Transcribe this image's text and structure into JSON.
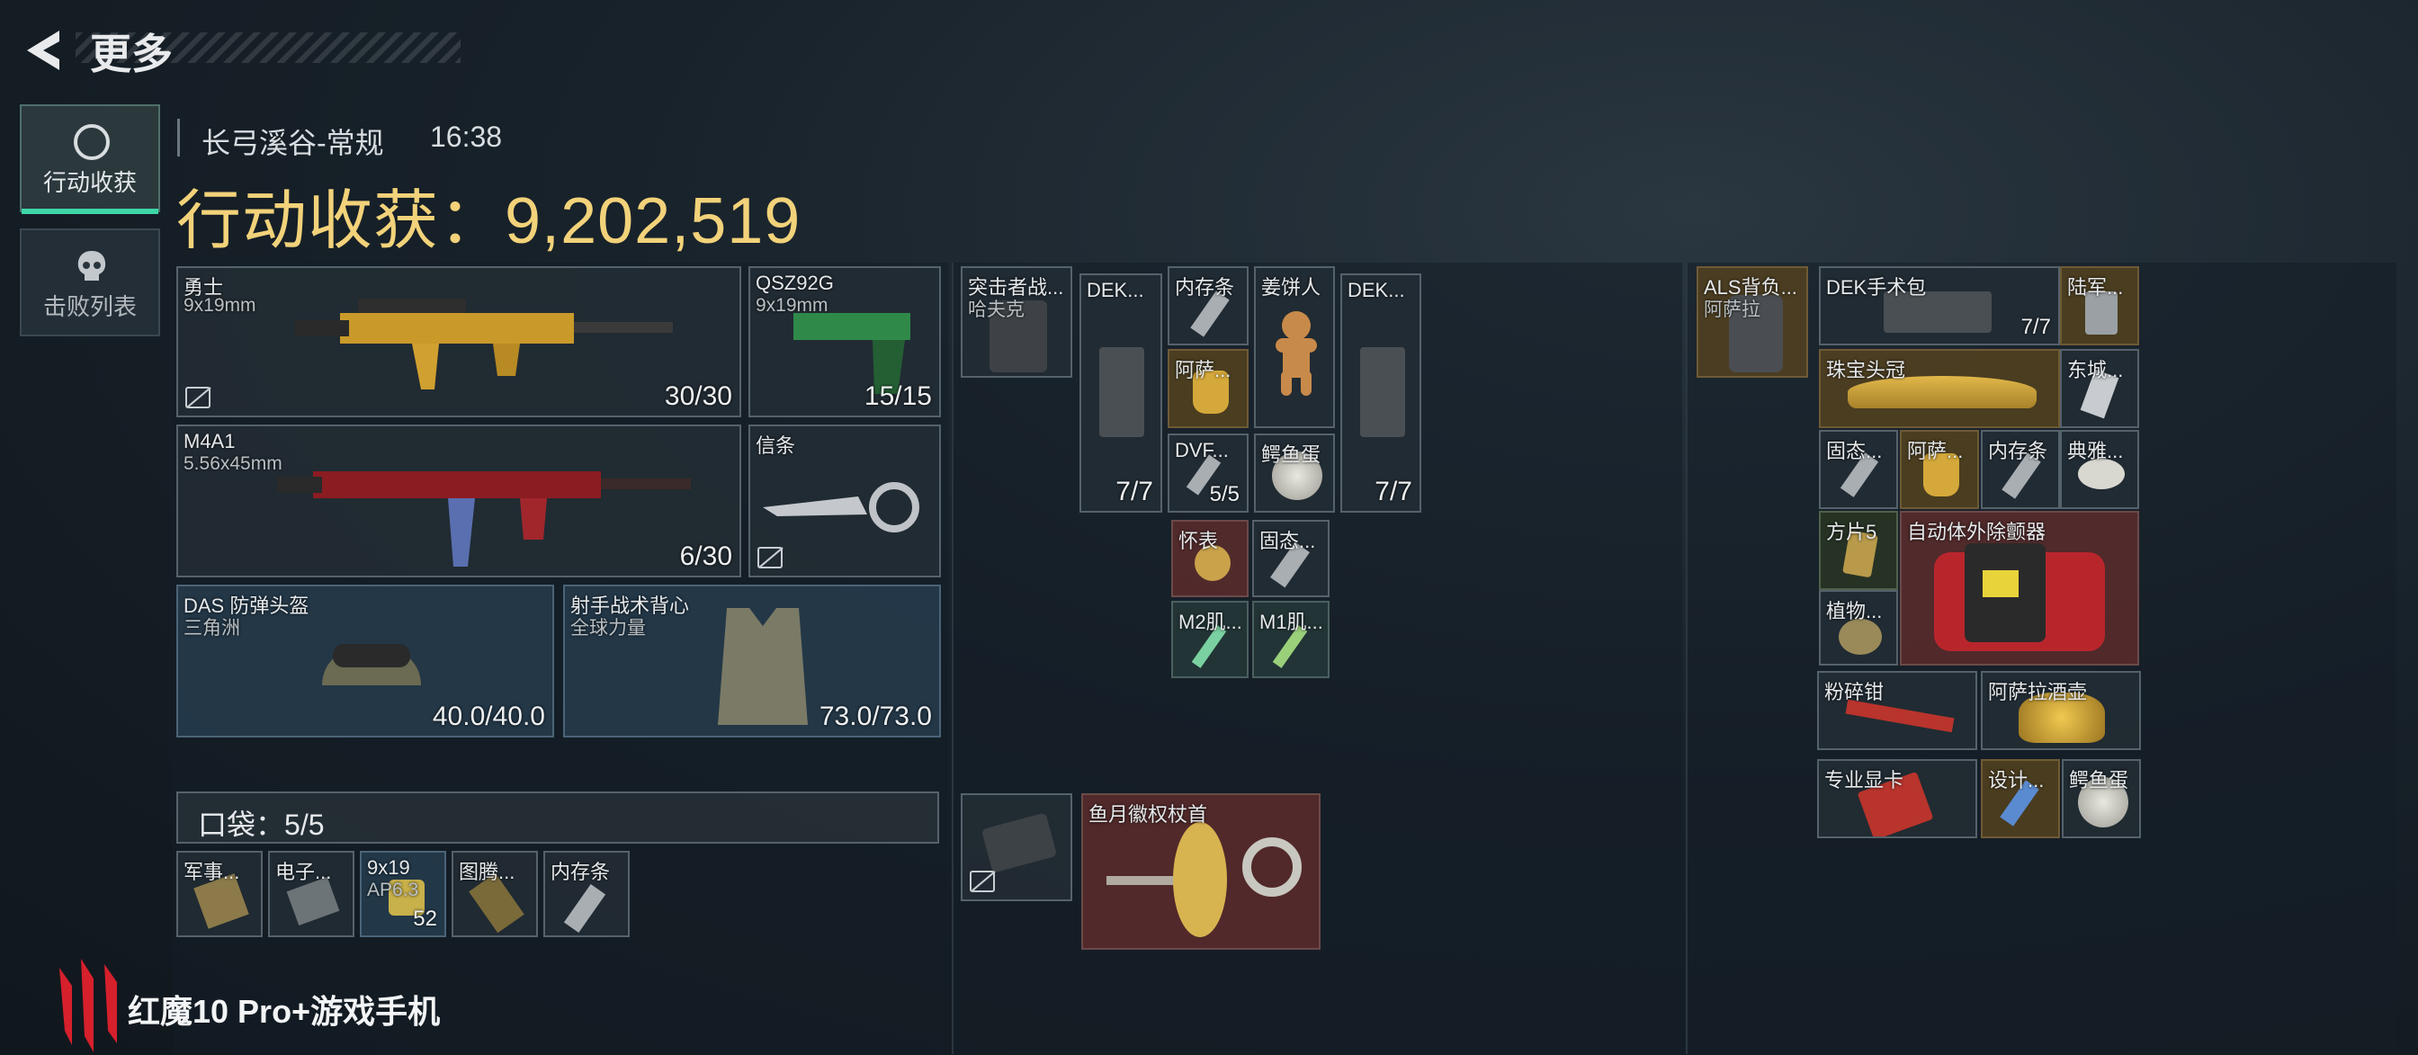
{
  "header": {
    "title": "更多"
  },
  "tabs": [
    {
      "label": "行动收获",
      "active": true
    },
    {
      "label": "击败列表",
      "active": false
    }
  ],
  "raid": {
    "map": "长弓溪谷-常规",
    "time": "16:38",
    "harvest_label": "行动收获：",
    "harvest_value": "9,202,519"
  },
  "loadout": {
    "primary1": {
      "name": "勇士",
      "ammo": "9x19mm",
      "count": "30/30"
    },
    "pistol": {
      "name": "QSZ92G",
      "ammo": "9x19mm",
      "count": "15/15"
    },
    "primary2": {
      "name": "M4A1",
      "ammo": "5.56x45mm",
      "count": "6/30"
    },
    "melee": {
      "name": "信条"
    },
    "helmet": {
      "name": "DAS 防弹头盔",
      "sub": "三角洲",
      "durability": "40.0/40.0"
    },
    "armor": {
      "name": "射手战术背心",
      "sub": "全球力量",
      "durability": "73.0/73.0"
    },
    "pocket": {
      "label": "口袋：",
      "count": "5/5"
    },
    "pocket_items": [
      {
        "name": "军事..."
      },
      {
        "name": "电子..."
      },
      {
        "name": "9x19",
        "sub": "AP6.3",
        "count": "52"
      },
      {
        "name": "图腾..."
      },
      {
        "name": "内存条"
      }
    ]
  },
  "chest_rig": {
    "rig": {
      "name": "突击者战...",
      "sub": "哈夫克"
    },
    "items": [
      {
        "name": "DEK...",
        "count": "7/7"
      },
      {
        "name": "内存条"
      },
      {
        "name": "姜饼人"
      },
      {
        "name": "DEK...",
        "count": "7/7"
      },
      {
        "name": "阿萨..."
      },
      {
        "name": "DVF...",
        "count": "5/5"
      },
      {
        "name": "鳄鱼蛋"
      },
      {
        "name": "怀表"
      },
      {
        "name": "固态..."
      },
      {
        "name": "M2肌..."
      },
      {
        "name": "M1肌..."
      }
    ],
    "special": {
      "name": "鱼月徽权杖首"
    }
  },
  "backpack": {
    "bag": {
      "name": "ALS背负...",
      "sub": "阿萨拉"
    },
    "items": [
      {
        "name": "DEK手术包",
        "count": "7/7"
      },
      {
        "name": "陆军..."
      },
      {
        "name": "珠宝头冠"
      },
      {
        "name": "东城..."
      },
      {
        "name": "固态..."
      },
      {
        "name": "阿萨..."
      },
      {
        "name": "内存条"
      },
      {
        "name": "典雅..."
      },
      {
        "name": "方片5"
      },
      {
        "name": "自动体外除颤器"
      },
      {
        "name": "植物..."
      },
      {
        "name": "粉碎钳"
      },
      {
        "name": "阿萨拉酒壶"
      },
      {
        "name": "专业显卡"
      },
      {
        "name": "设计..."
      },
      {
        "name": "鳄鱼蛋"
      }
    ]
  },
  "brand": {
    "text": "红魔10 Pro+游戏手机"
  },
  "colors": {
    "accent": "#3ed6a6",
    "harvest": "#f2d27a",
    "red_slot": "#5c2c2c",
    "gold_slot": "#54421e",
    "blue_slot": "#263c4e"
  }
}
